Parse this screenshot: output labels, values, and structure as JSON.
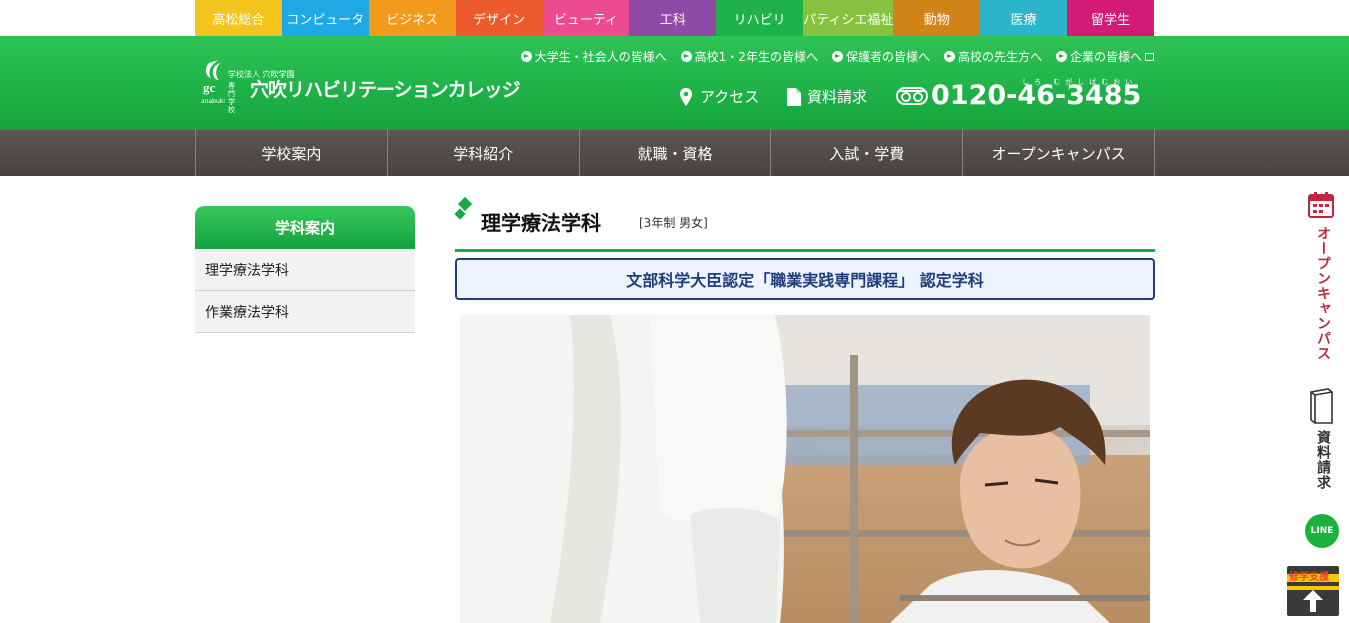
{
  "departments": [
    {
      "label": "高松総合",
      "color": "#f3c41b"
    },
    {
      "label": "コンピュータ",
      "color": "#1fa8e6"
    },
    {
      "label": "ビジネス",
      "color": "#f39a1d"
    },
    {
      "label": "デザイン",
      "color": "#ed5a2c"
    },
    {
      "label": "ビューティ",
      "color": "#ec4b90"
    },
    {
      "label": "工科",
      "color": "#8f4aa6"
    },
    {
      "label": "リハビリ",
      "color": "#1fb24a"
    },
    {
      "label": "パティシエ福祉",
      "color": "#86c23f"
    },
    {
      "label": "動物",
      "color": "#d38419"
    },
    {
      "label": "医療",
      "color": "#2cb6c9"
    },
    {
      "label": "留学生",
      "color": "#d21b77"
    }
  ],
  "logo": {
    "corp": "学校法人 穴吹学園",
    "type": "専門学校",
    "name": "穴吹リハビリテーションカレッジ",
    "brand": "anabuki"
  },
  "audience_links": [
    {
      "label": "大学生・社会人の皆様へ"
    },
    {
      "label": "高校1・2年生の皆様へ"
    },
    {
      "label": "保護者の皆様へ"
    },
    {
      "label": "高校の先生方へ"
    },
    {
      "label": "企業の皆様へ"
    }
  ],
  "header": {
    "access": "アクセス",
    "document_request": "資料請求",
    "tel": "0120-46-3485",
    "tel_ruby": "しろ むがしばむおい"
  },
  "gnav": [
    {
      "label": "学校案内"
    },
    {
      "label": "学科紹介"
    },
    {
      "label": "就職・資格"
    },
    {
      "label": "入試・学費"
    },
    {
      "label": "オープンキャンパス"
    }
  ],
  "sidebar": {
    "title": "学科案内",
    "items": [
      {
        "label": "理学療法学科"
      },
      {
        "label": "作業療法学科"
      }
    ]
  },
  "main": {
    "title": "理学療法学科",
    "subtitle": "[3年制 男女]",
    "certification": "文部科学大臣認定「職業実践専門課程」 認定学科"
  },
  "floating": {
    "open_campus": "オープンキャンパス",
    "document_request": "資料請求",
    "line": "LINE",
    "page_top_label": "修学支援"
  },
  "colors": {
    "header_green": "#1db44a",
    "nav_gray": "#524a48",
    "cert_navy": "#1f3e7a",
    "open_campus_red": "#c0283f"
  }
}
